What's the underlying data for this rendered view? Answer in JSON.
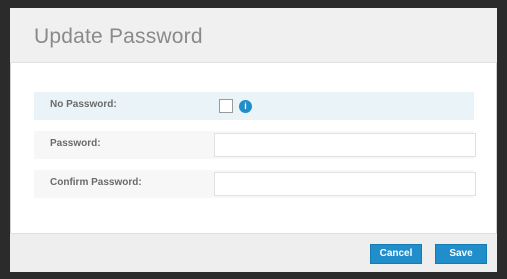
{
  "dialog": {
    "title": "Update Password"
  },
  "form": {
    "no_password_label": "No Password:",
    "no_password_checked": false,
    "info_icon": "info-icon",
    "info_glyph": "i",
    "password_label": "Password:",
    "password_value": "",
    "confirm_label": "Confirm Password:",
    "confirm_value": ""
  },
  "footer": {
    "cancel_label": "Cancel",
    "save_label": "Save"
  },
  "colors": {
    "accent": "#1f8ecb",
    "highlight_row": "#eaf4f8",
    "header_bg": "#f0f0f0"
  }
}
